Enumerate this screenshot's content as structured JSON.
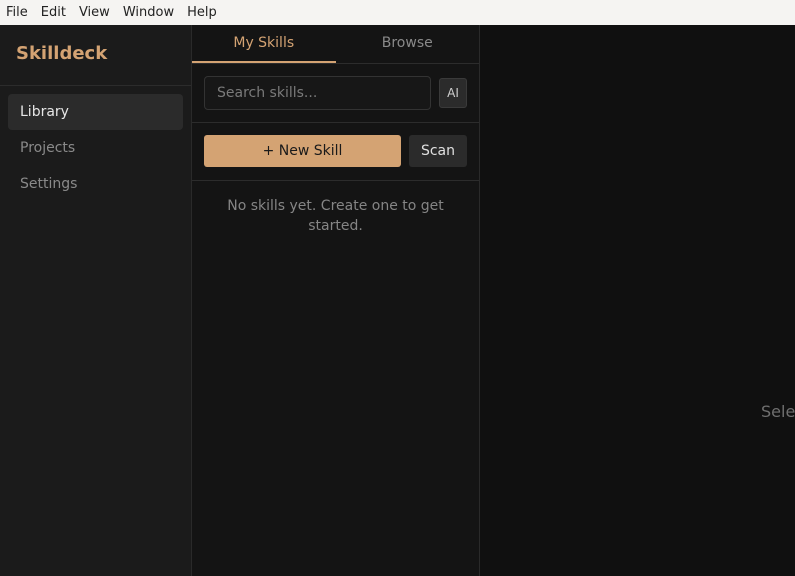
{
  "menubar": {
    "items": [
      "File",
      "Edit",
      "View",
      "Window",
      "Help"
    ]
  },
  "sidebar": {
    "brand": "Skilldeck",
    "items": [
      {
        "label": "Library",
        "active": true
      },
      {
        "label": "Projects",
        "active": false
      },
      {
        "label": "Settings",
        "active": false
      }
    ]
  },
  "list": {
    "tabs": [
      {
        "label": "My Skills",
        "active": true
      },
      {
        "label": "Browse",
        "active": false
      }
    ],
    "search": {
      "placeholder": "Search skills...",
      "value": ""
    },
    "ai_label": "AI",
    "new_skill_label": "+ New Skill",
    "scan_label": "Scan",
    "empty_message": "No skills yet. Create one to get started."
  },
  "detail": {
    "placeholder": "Sele"
  },
  "colors": {
    "accent": "#d4a373",
    "background": "#111111",
    "sidebar": "#1b1b1b"
  }
}
